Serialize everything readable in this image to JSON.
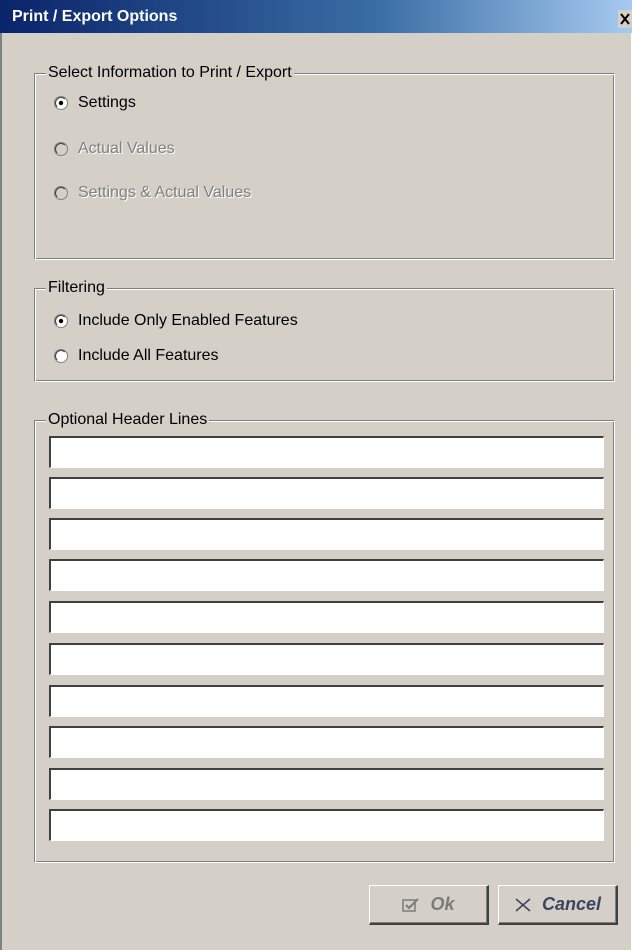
{
  "window": {
    "title": "Print / Export Options"
  },
  "info_group": {
    "legend": "Select Information to Print / Export",
    "options": [
      {
        "label": "Settings",
        "selected": true,
        "enabled": true
      },
      {
        "label": "Actual Values",
        "selected": false,
        "enabled": false
      },
      {
        "label": "Settings & Actual Values",
        "selected": false,
        "enabled": false
      }
    ]
  },
  "filter_group": {
    "legend": "Filtering",
    "options": [
      {
        "label": "Include Only Enabled Features",
        "selected": true,
        "enabled": true
      },
      {
        "label": "Include All Features",
        "selected": false,
        "enabled": true
      }
    ]
  },
  "header_group": {
    "legend": "Optional Header Lines",
    "lines": [
      "",
      "",
      "",
      "",
      "",
      "",
      "",
      "",
      "",
      ""
    ]
  },
  "buttons": {
    "ok_label": "Ok",
    "cancel_label": "Cancel"
  },
  "icons": {
    "close": "close-icon",
    "ok": "checkmark-icon",
    "cancel": "x-icon"
  },
  "colors": {
    "titlebar_start": "#0a246a",
    "titlebar_end": "#a6caf0",
    "dialog_face": "#d4d0c8",
    "disabled_text": "#808080"
  }
}
